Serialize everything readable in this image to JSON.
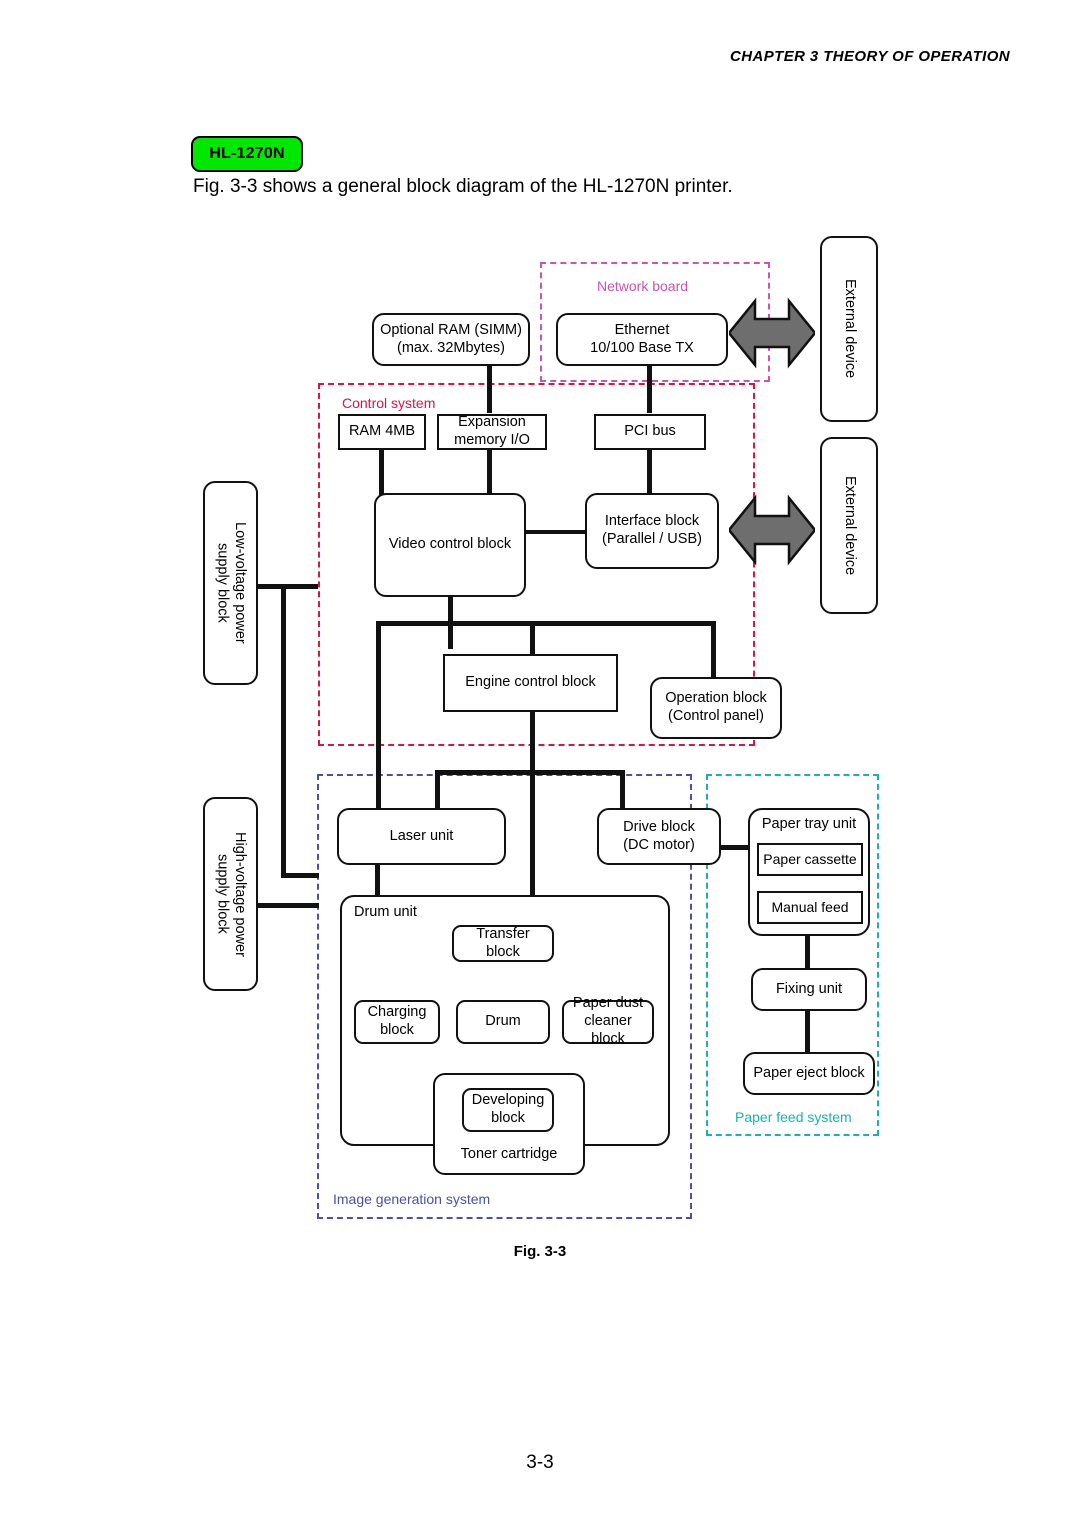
{
  "header": {
    "chapter": "CHAPTER 3  THEORY OF OPERATION"
  },
  "model_badge": "HL-1270N",
  "intro_text": "Fig. 3-3 shows a general block diagram of the HL-1270N printer.",
  "figure_caption": "Fig. 3-3",
  "page_number": "3-3",
  "colors": {
    "network_board": "#cc53b0",
    "control_system": "#d6164b",
    "image_generation_system": "#4b4fa8",
    "paper_feed_system": "#18b3b0",
    "badge_green": "#00e800",
    "arrow_grey": "#6e6e6e",
    "line_black": "#111111"
  },
  "groups": [
    {
      "id": "network-board",
      "label": "Network board",
      "color": "#cc53b0"
    },
    {
      "id": "control-system",
      "label": "Control system",
      "color": "#d6164b"
    },
    {
      "id": "image-generation-system",
      "label": "Image generation system",
      "color": "#4b4fa8"
    },
    {
      "id": "paper-feed-system",
      "label": "Paper feed system",
      "color": "#18b3b0"
    }
  ],
  "blocks": {
    "optional_ram": "Optional RAM (SIMM)\n(max. 32Mbytes)",
    "ethernet": "Ethernet\n10/100 Base TX",
    "external_device_1": "External device",
    "external_device_2": "External device",
    "ram_4mb": "RAM 4MB",
    "expansion_memory_io": "Expansion\nmemory I/O",
    "pci_bus": "PCI bus",
    "video_control_block": "Video control block",
    "interface_block": "Interface block\n(Parallel / USB)",
    "low_voltage_psu": "Low-voltage power\nsupply block",
    "high_voltage_psu": "High-voltage power\nsupply block",
    "engine_control_block": "Engine control block",
    "operation_block": "Operation block\n(Control  panel)",
    "laser_unit": "Laser unit",
    "drive_block": "Drive block\n(DC motor)",
    "drum_unit": "Drum unit",
    "transfer_block": "Transfer block",
    "charging_block": "Charging\nblock",
    "drum": "Drum",
    "paper_dust_cleaner_block": "Paper dust\ncleaner block",
    "developing_block": "Developing\nblock",
    "toner_cartridge": "Toner cartridge",
    "paper_tray_unit": "Paper tray unit",
    "paper_cassette": "Paper cassette",
    "manual_feed": "Manual feed",
    "fixing_unit": "Fixing unit",
    "paper_eject_block": "Paper eject block"
  }
}
